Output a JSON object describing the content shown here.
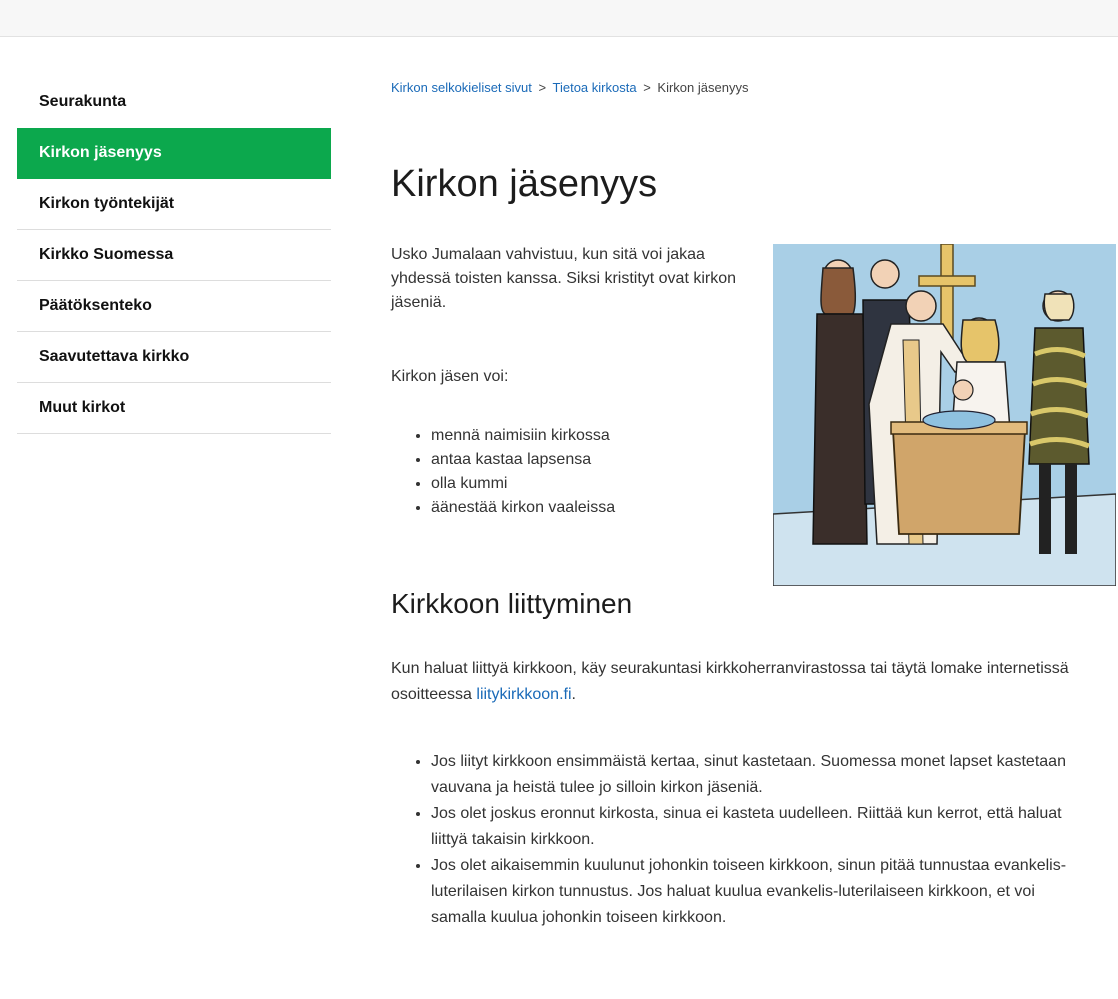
{
  "sidebar": {
    "items": [
      {
        "label": "Seurakunta"
      },
      {
        "label": "Kirkon jäsenyys"
      },
      {
        "label": "Kirkon työntekijät"
      },
      {
        "label": "Kirkko Suomessa"
      },
      {
        "label": "Päätöksenteko"
      },
      {
        "label": "Saavutettava kirkko"
      },
      {
        "label": "Muut kirkot"
      }
    ],
    "active_color": "#0ca84d"
  },
  "breadcrumb": {
    "items": [
      "Kirkon selkokieliset sivut",
      "Tietoa kirkosta"
    ],
    "current": "Kirkon jäsenyys",
    "separator": ">"
  },
  "main": {
    "title": "Kirkon jäsenyys",
    "intro": "Usko Jumalaan vahvistuu, kun sitä voi jakaa yhdessä toisten kanssa. Siksi kristityt ovat kirkon jäseniä.",
    "member_can": "Kirkon jäsen voi:",
    "rights": [
      "mennä naimisiin kirkossa",
      "antaa kastaa lapsensa",
      "olla kummi",
      "äänestää kirkon vaaleissa"
    ],
    "subtitle": "Kirkkoon liittyminen",
    "join_text": "Kun haluat liittyä kirkkoon, käy seurakuntasi kirkkoherranvirastossa tai täytä lomake internetissä osoitteessa",
    "join_link": "liitykirkkoon.fi",
    "join_end": ".",
    "join_points": [
      "Jos liityt kirkkoon ensimmäistä kertaa, sinut kastetaan. Suomessa monet lapset kastetaan vauvana ja heistä tulee jo silloin kirkon jäseniä.",
      "Jos olet joskus eronnut kirkosta, sinua ei kasteta uudelleen. Riittää kun kerrot, että haluat liittyä takaisin kirkkoon.",
      "Jos olet aikaisemmin kuulunut johonkin toiseen kirkkoon, sinun pitää tunnustaa evankelis-luterilaisen kirkon tunnustus. Jos haluat kuulua evankelis-luterilaiseen kirkkoon, et voi samalla kuulua johonkin toiseen kirkkoon."
    ]
  },
  "colors": {
    "link": "#1a6ab8",
    "accent": "#0ca84d",
    "image_background": "#a9cfe6"
  }
}
